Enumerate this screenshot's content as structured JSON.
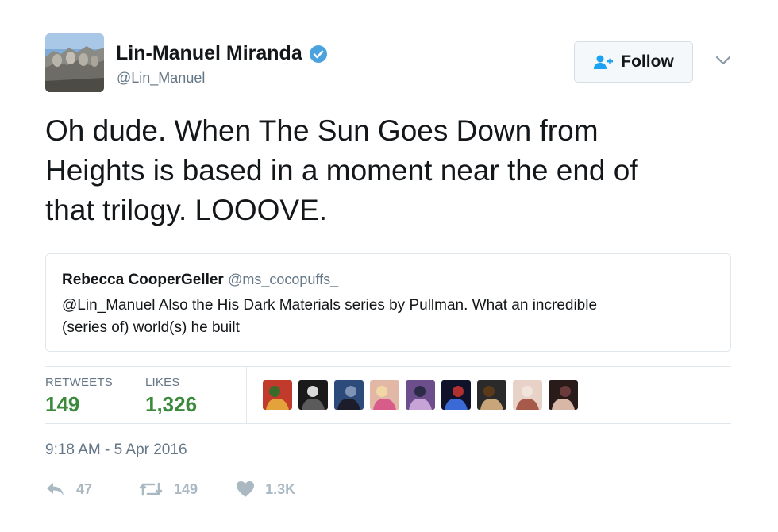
{
  "author": {
    "name": "Lin-Manuel Miranda",
    "handle": "@Lin_Manuel",
    "avatar_icon": "avatar-mountain-photo",
    "verified_icon": "verified-badge-icon",
    "verified_color": "#4aa3df"
  },
  "follow_button": {
    "label": "Follow",
    "icon": "add-user-icon",
    "accent": "#1da1f2"
  },
  "menu_icon": "chevron-down-icon",
  "tweet": {
    "text_lines": [
      "Oh dude. When The Sun Goes Down from",
      "Heights is based in a moment near the end of",
      "that trilogy. LOOOVE."
    ]
  },
  "quoted_tweet": {
    "name": "Rebecca CooperGeller",
    "handle": "@ms_cocopuffs_",
    "text_lines": [
      "@Lin_Manuel Also the His Dark Materials series by Pullman. What an incredible",
      "(series of) world(s) he built"
    ]
  },
  "stats": {
    "retweets_label": "RETWEETS",
    "retweets_value": "149",
    "likes_label": "LIKES",
    "likes_value": "1,326",
    "value_color": "#3b8a3b"
  },
  "likers": [
    {
      "name": "liker-avatar-1",
      "colors": [
        "#c23a2b",
        "#e4a33a",
        "#3b6b2a"
      ]
    },
    {
      "name": "liker-avatar-2",
      "colors": [
        "#1a1a1a",
        "#5b5b5b",
        "#d9d9d9"
      ]
    },
    {
      "name": "liker-avatar-3",
      "colors": [
        "#2d4b7a",
        "#1c1c2a",
        "#7e93b5"
      ]
    },
    {
      "name": "liker-avatar-4",
      "colors": [
        "#e3b7a6",
        "#d85c8a",
        "#f1d7a3"
      ]
    },
    {
      "name": "liker-avatar-5",
      "colors": [
        "#6c4e8c",
        "#c7a4d8",
        "#2b2b48"
      ]
    },
    {
      "name": "liker-avatar-6",
      "colors": [
        "#10122a",
        "#3b6ad6",
        "#b03030"
      ]
    },
    {
      "name": "liker-avatar-7",
      "colors": [
        "#2a2a2a",
        "#c9a57a",
        "#5a3a1a"
      ]
    },
    {
      "name": "liker-avatar-8",
      "colors": [
        "#e8d2c8",
        "#a85a4a",
        "#f0e4dc"
      ]
    },
    {
      "name": "liker-avatar-9",
      "colors": [
        "#2a1b1b",
        "#d8b7a6",
        "#6b3b3b"
      ]
    }
  ],
  "timestamp": "9:18 AM - 5 Apr 2016",
  "actions": {
    "reply": {
      "icon": "reply-icon",
      "count": "47"
    },
    "retweet": {
      "icon": "retweet-icon",
      "count": "149"
    },
    "like": {
      "icon": "heart-icon",
      "count": "1.3K"
    },
    "color": "#aab8c2"
  }
}
